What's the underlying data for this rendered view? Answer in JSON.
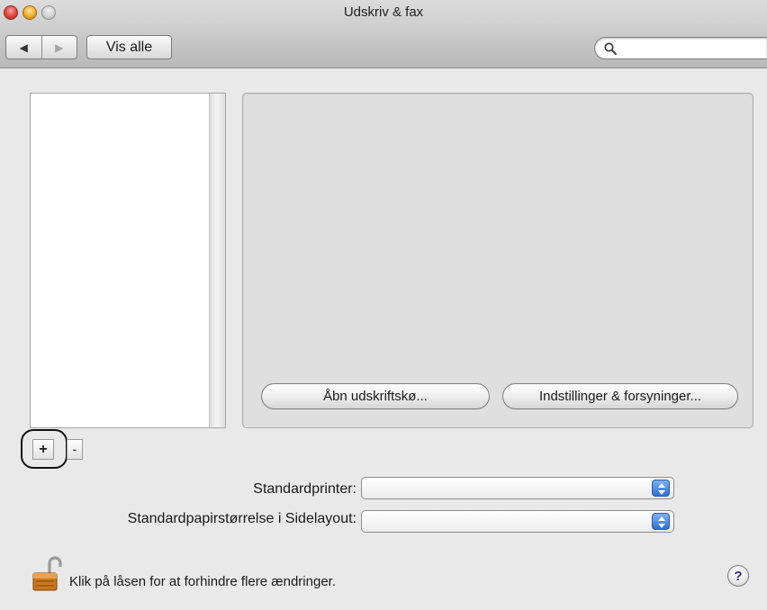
{
  "window": {
    "title": "Udskriv & fax"
  },
  "toolbar": {
    "back_glyph": "◀",
    "forward_glyph": "▶",
    "show_all_label": "Vis alle",
    "search_placeholder": ""
  },
  "printer_list": {
    "items": []
  },
  "list_controls": {
    "add_label": "+",
    "remove_label": "-"
  },
  "details": {
    "open_queue_label": "Åbn udskriftskø...",
    "settings_label": "Indstillinger & forsyninger..."
  },
  "defaults": {
    "printer_label": "Standardprinter:",
    "printer_value": "",
    "paper_label": "Standardpapirstørrelse i Sidelayout:",
    "paper_value": ""
  },
  "footer": {
    "lock_text": "Klik på låsen for at forhindre flere ændringer.",
    "help_label": "?"
  },
  "icons": {
    "close": "close-icon",
    "minimize": "minimize-icon",
    "zoom": "zoom-icon",
    "search": "search-icon",
    "lock": "unlocked-padlock-icon",
    "help": "help-icon"
  },
  "colors": {
    "close": "#e0443a",
    "minimize": "#f1ac2c",
    "zoom": "#cfcfcf",
    "popup_accent": "#2f6fd6"
  }
}
